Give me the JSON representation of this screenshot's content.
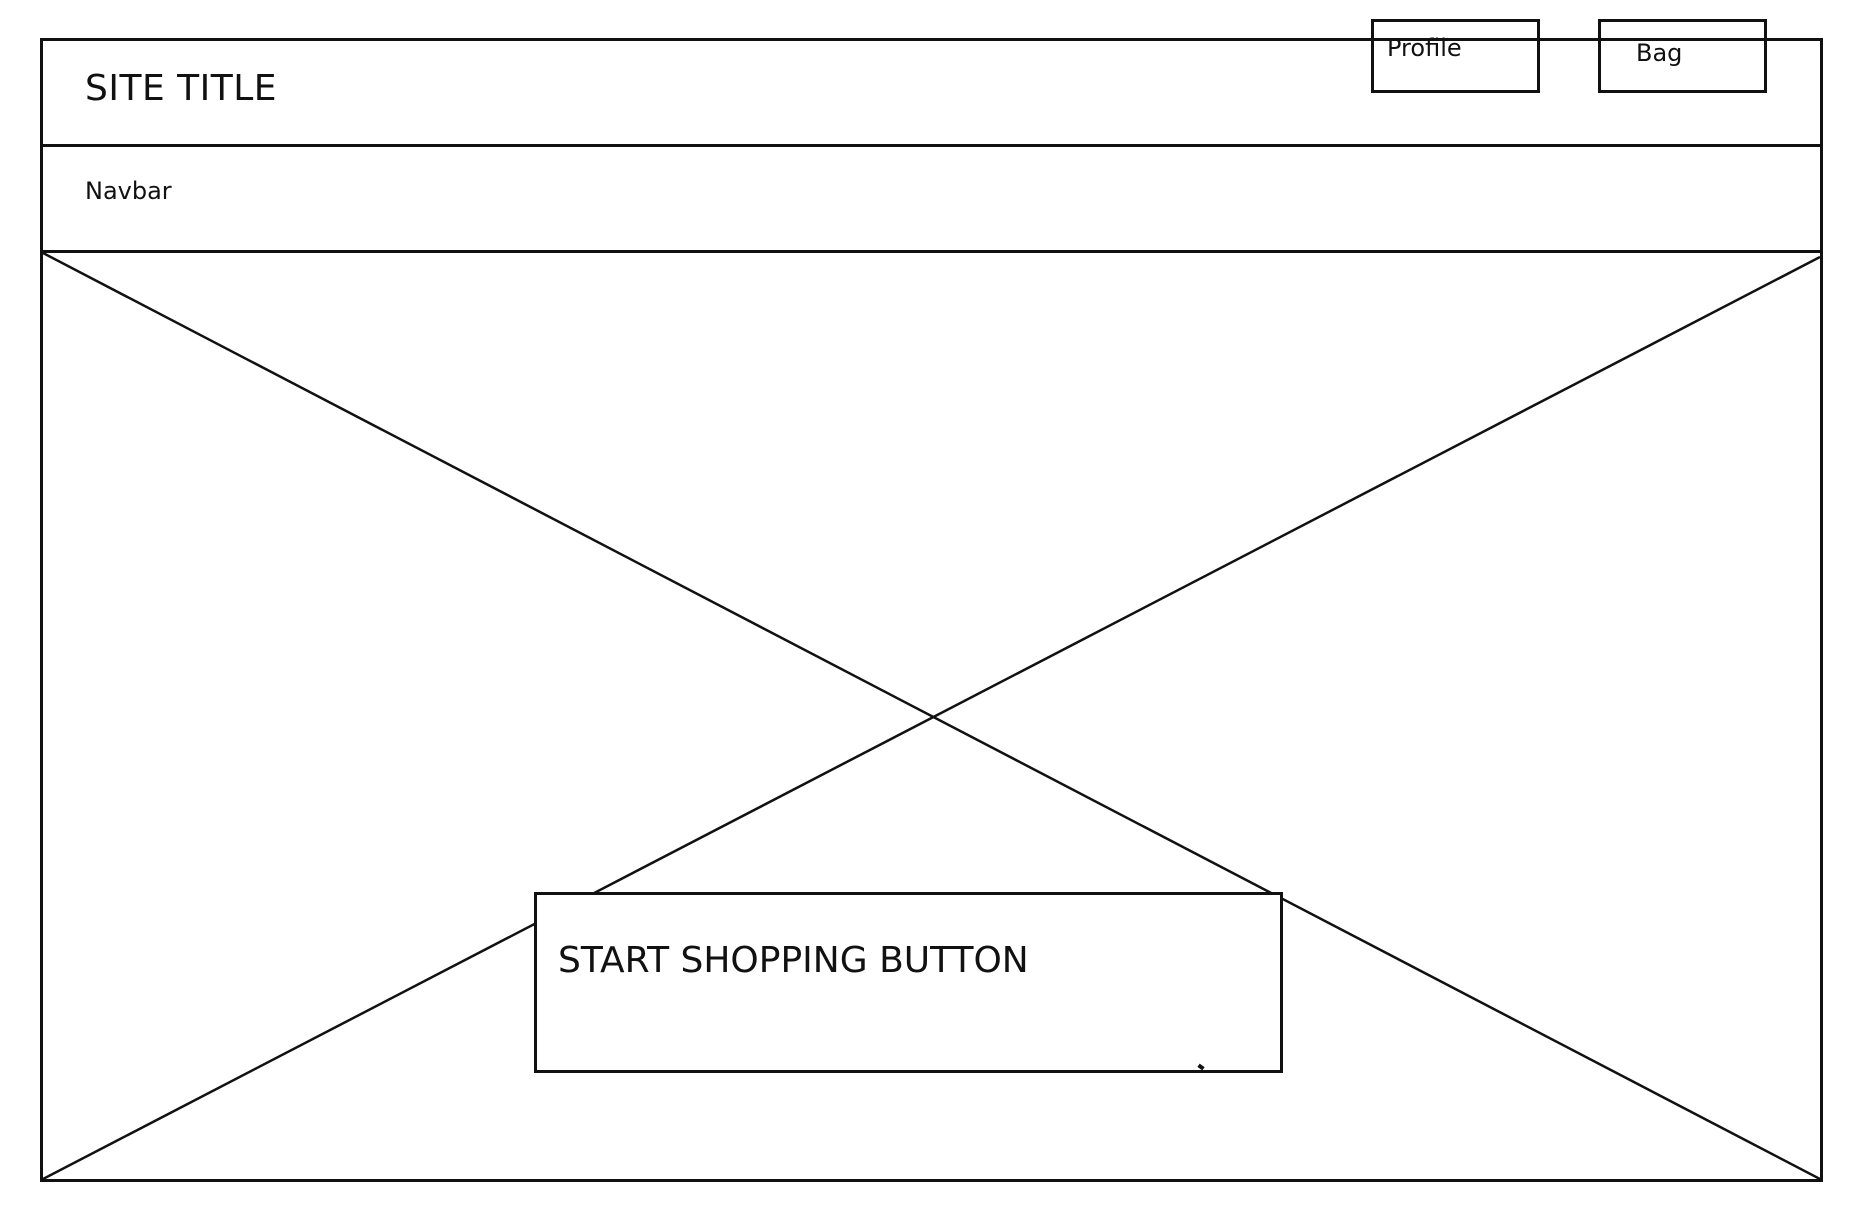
{
  "header": {
    "site_title": "SITE TITLE",
    "profile_label": "Profile",
    "bag_label": "Bag"
  },
  "navbar": {
    "label": "Navbar"
  },
  "hero": {
    "image_placeholder": "image-placeholder",
    "cta_label": "START SHOPPING BUTTON"
  }
}
